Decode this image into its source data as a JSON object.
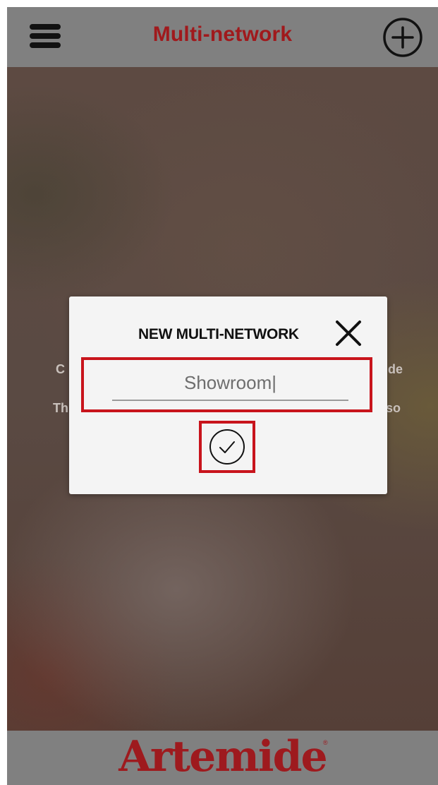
{
  "header": {
    "title": "Multi-network",
    "menu_icon": "hamburger-menu-icon",
    "add_icon": "plus-circle-icon"
  },
  "background_text": {
    "line1_left": "C",
    "line1_right": "de",
    "line2_left": "Th",
    "line2_right": "so"
  },
  "dialog": {
    "title": "NEW MULTI-NETWORK",
    "close_icon": "close-icon",
    "name_value": "Showroom|",
    "confirm_icon": "check-circle-icon"
  },
  "footer": {
    "brand": "Artemide",
    "registered_mark": "®"
  },
  "colors": {
    "accent_red": "#a0191c",
    "highlight_red": "#c8141c",
    "bar_gray": "#808080",
    "dialog_bg": "#f4f4f4"
  }
}
